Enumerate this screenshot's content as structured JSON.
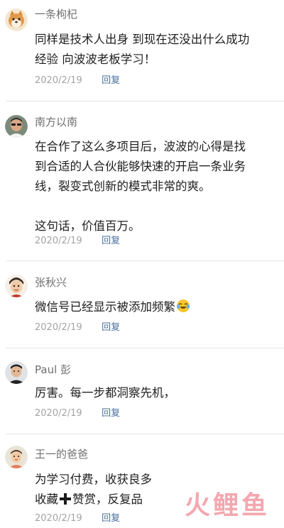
{
  "comments": [
    {
      "name": "一条枸杞",
      "lines": [
        "同样是技术人出身 到现在还没出什么成功",
        "经验 向波波老板学习！"
      ],
      "date": "2020/2/19",
      "reply": "回复",
      "avatar_icon": "shiba-dog-avatar"
    },
    {
      "name": "南方以南",
      "lines": [
        "在合作了这么多项目后，波波的心得是找",
        "到合适的人合伙能够快速的开启一条业务",
        "线，裂变式创新的模式非常的爽。",
        "",
        "这句话，价值百万。"
      ],
      "date": "2020/2/19",
      "reply": "回复",
      "avatar_icon": "man-sunglasses-avatar"
    },
    {
      "name": "张秋兴",
      "lines": [
        "微信号已经显示被添加频繁"
      ],
      "emoji": "laughing-crying-emoji",
      "date": "2020/2/19",
      "reply": "回复",
      "avatar_icon": "cartoon-person-avatar"
    },
    {
      "name": "Paul 彭",
      "lines": [
        "厉害。每一步都洞察先机，"
      ],
      "date": "2020/2/19",
      "reply": "回复",
      "avatar_icon": "man-portrait-avatar"
    },
    {
      "name": "王一的爸爸",
      "line1": "为学习付费，收获良多",
      "line2_a": "收藏",
      "line2_b": "赞赏，反复品",
      "date": "2020/2/19",
      "reply": "回复",
      "avatar_icon": "child-avatar"
    }
  ],
  "watermark": {
    "text": "火鲤鱼"
  },
  "colors": {
    "name": "#6f6f6f",
    "date": "#a3a3a3",
    "reply": "#4a6f9d",
    "watermark": "#eb5f6e"
  }
}
